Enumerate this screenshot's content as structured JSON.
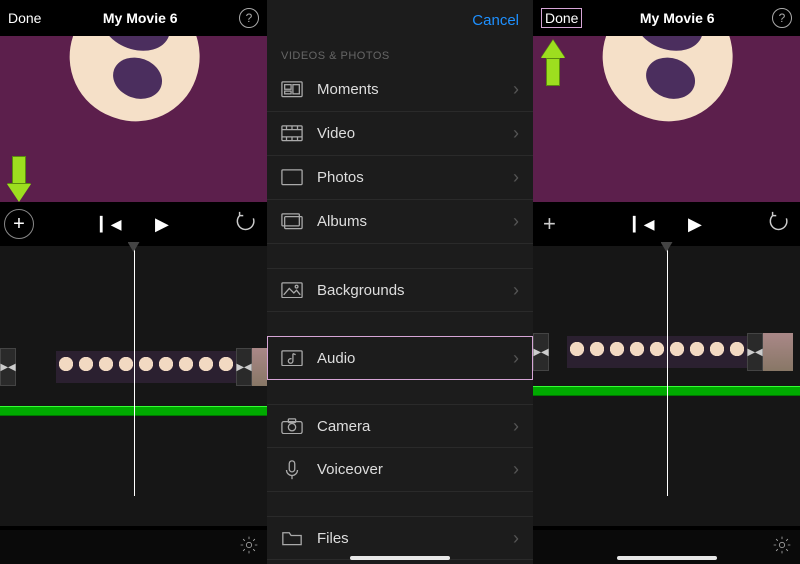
{
  "panel1": {
    "done": "Done",
    "title": "My Movie 6"
  },
  "panel3": {
    "done": "Done",
    "title": "My Movie 6"
  },
  "menu": {
    "cancel": "Cancel",
    "section": "VIDEOS & PHOTOS",
    "items": {
      "moments": "Moments",
      "video": "Video",
      "photos": "Photos",
      "albums": "Albums",
      "backgrounds": "Backgrounds",
      "audio": "Audio",
      "camera": "Camera",
      "voiceover": "Voiceover",
      "files": "Files"
    }
  }
}
